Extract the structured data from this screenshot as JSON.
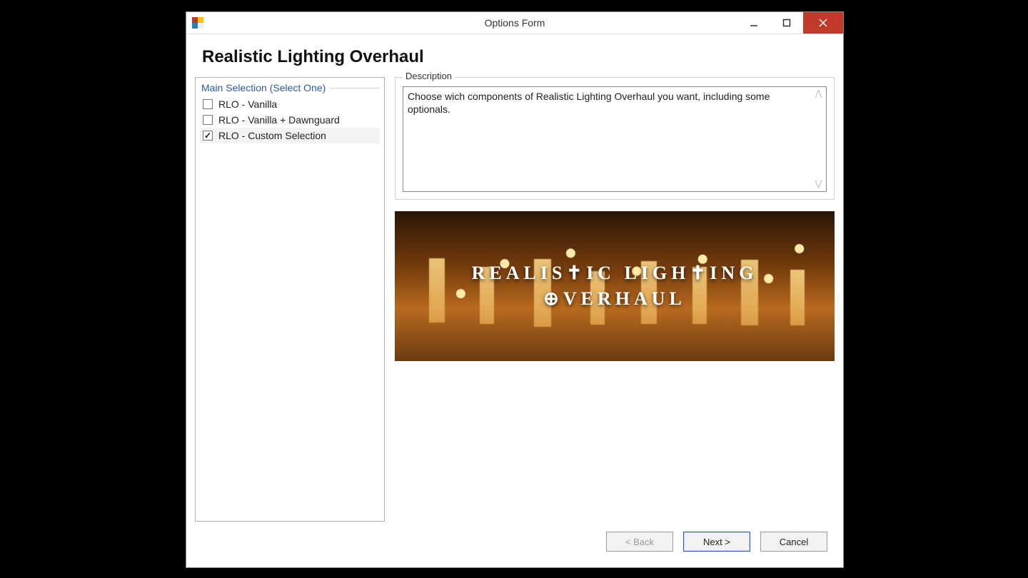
{
  "window": {
    "title": "Options Form"
  },
  "page": {
    "heading": "Realistic Lighting Overhaul"
  },
  "selection": {
    "group_label": "Main Selection (Select One)",
    "options": [
      {
        "label": "RLO - Vanilla",
        "checked": false
      },
      {
        "label": "RLO - Vanilla + Dawnguard",
        "checked": false
      },
      {
        "label": "RLO - Custom Selection",
        "checked": true
      }
    ]
  },
  "description": {
    "legend": "Description",
    "text": "Choose wich components of Realistic Lighting Overhaul you want, including some optionals."
  },
  "preview": {
    "line1": "REALIS✝IC LIGH✝ING",
    "line2": "⊕VERHAUL"
  },
  "buttons": {
    "back": "< Back",
    "next": "Next >",
    "cancel": "Cancel"
  }
}
